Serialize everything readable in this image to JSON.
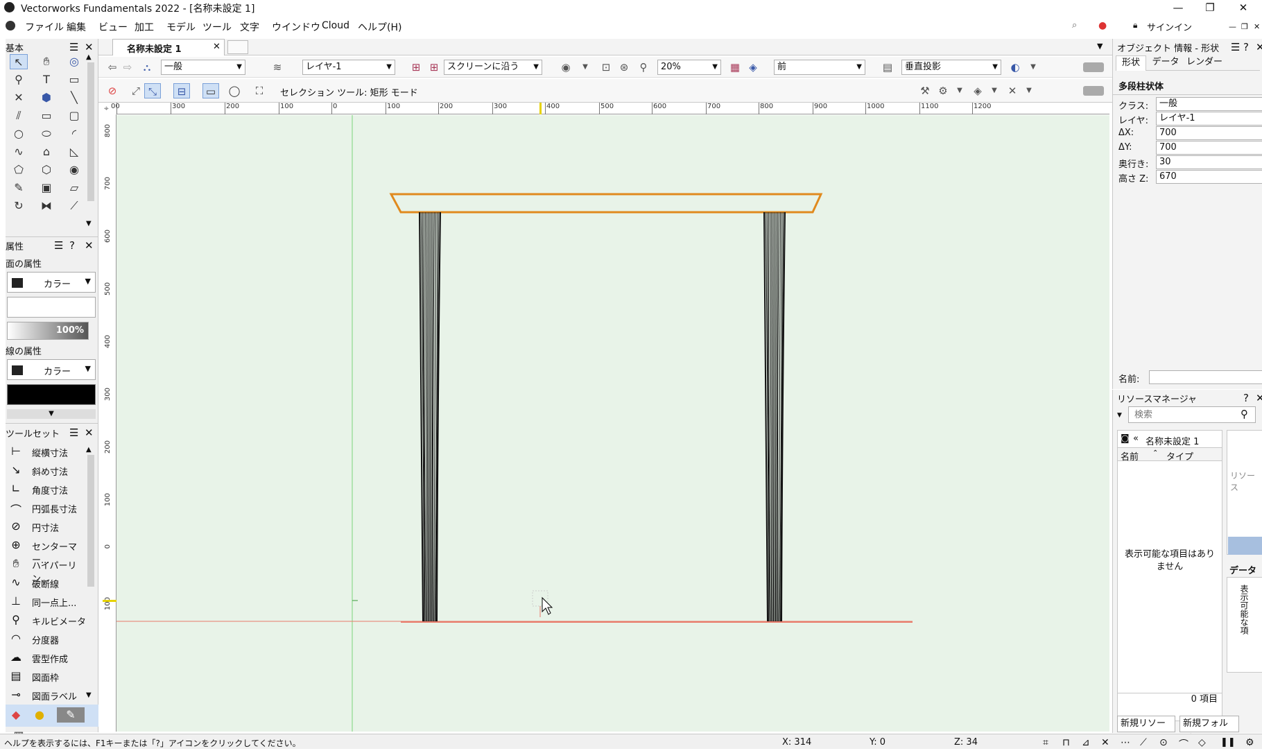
{
  "app": {
    "title": "Vectorworks Fundamentals 2022 - [名称未設定 1]",
    "window_buttons": [
      "—",
      "❐",
      "✕"
    ]
  },
  "menu": [
    "ファイル",
    "編集",
    "ビュー",
    "加工",
    "モデル",
    "ツール",
    "文字",
    "ウインドウ",
    "Cloud",
    "ヘルプ(H)"
  ],
  "menu_right": {
    "signin": "サインイン"
  },
  "left_palette": {
    "basic_title": "基本",
    "attr_title": "属性",
    "fill_attr": "面の属性",
    "fill_color": "カラー",
    "opacity": "100%",
    "line_attr": "線の属性",
    "line_color": "カラー",
    "toolset_title": "ツールセット",
    "toolset_items": [
      "縦横寸法",
      "斜め寸法",
      "角度寸法",
      "円弧長寸法",
      "円寸法",
      "センターマー...",
      "ハイパーリン...",
      "破断線",
      "同一点上...",
      "キルビメータ",
      "分度器",
      "雲型作成",
      "図面枠",
      "図面ラベル"
    ]
  },
  "document": {
    "tab": "名称未設定 1",
    "class_dd": "一般",
    "layer_dd": "レイヤ-1",
    "screen_dd": "スクリーンに沿う",
    "zoom_dd": "20%",
    "view_dd": "前",
    "projection_dd": "垂直投影",
    "mode_text": "セレクション ツール: 矩形 モード"
  },
  "ruler_h": [
    "00",
    "300",
    "200",
    "100",
    "0",
    "100",
    "200",
    "300",
    "400",
    "500",
    "600",
    "700",
    "800",
    "900",
    "1000",
    "1100",
    "1200"
  ],
  "ruler_v": [
    "800",
    "700",
    "600",
    "500",
    "400",
    "300",
    "200",
    "100",
    "0",
    "100"
  ],
  "obj_info": {
    "title": "オブジェクト 情報 - 形状",
    "tabs": [
      "形状",
      "データ",
      "レンダー"
    ],
    "object_type": "多段柱状体",
    "fields": [
      {
        "label": "クラス:",
        "value": "一般"
      },
      {
        "label": "レイヤ:",
        "value": "レイヤ-1"
      },
      {
        "label": "ΔX:",
        "value": "700"
      },
      {
        "label": "ΔY:",
        "value": "700"
      },
      {
        "label": "奥行き:",
        "value": "30"
      },
      {
        "label": "高さ Z:",
        "value": "670"
      }
    ],
    "name_label": "名前:"
  },
  "resource_manager": {
    "title": "リソースマネージャ",
    "search_placeholder": "検索",
    "file": "名称未設定 1",
    "col_name": "名前",
    "col_type": "タイプ",
    "empty": "表示可能な項目はありません",
    "count": "0 項目",
    "new_resource": "新規リソース...",
    "new_folder": "新規フォルダ...",
    "side_label": "リソース",
    "data_label": "データ",
    "side_vertical": "表示可能な項"
  },
  "status": {
    "help": "ヘルプを表示するには、F1キーまたは「?」アイコンをクリックしてください。",
    "x": "X: 314",
    "y": "Y: 0",
    "z": "Z: 34"
  },
  "colors": {
    "canvas_bg": "#e8f3e8",
    "tabletop_stroke": "#e08a1e",
    "ground_line": "#e87a6a",
    "guide_line": "#7ad47a",
    "selection": "#3858a8"
  }
}
